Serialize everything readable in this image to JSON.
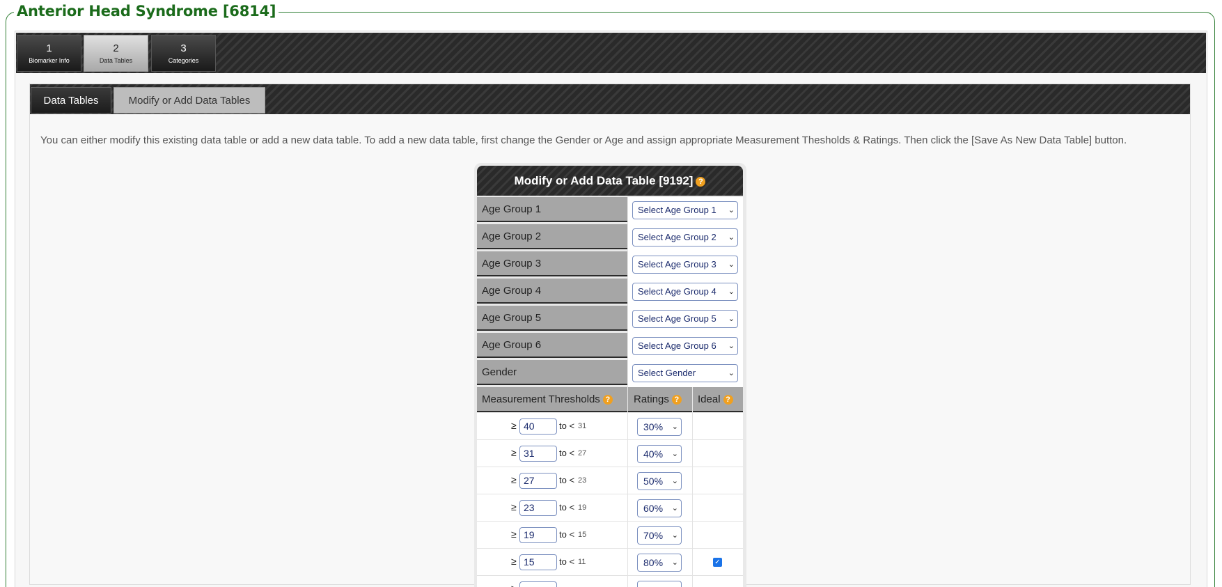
{
  "page": {
    "legend": "Anterior Head Syndrome [6814]",
    "intro": "You can either modify this existing data table or add a new data table. To add a new data table, first change the Gender or Age and assign appropriate Measurement Thesholds & Ratings. Then click the [Save As New Data Table] button."
  },
  "steps": [
    {
      "num": "1",
      "label": "Biomarker Info"
    },
    {
      "num": "2",
      "label": "Data Tables"
    },
    {
      "num": "3",
      "label": "Categories"
    }
  ],
  "tabs": [
    {
      "label": "Data Tables"
    },
    {
      "label": "Modify or Add Data Tables"
    }
  ],
  "form": {
    "title": "Modify or Add Data Table [9192]",
    "fields": [
      {
        "label": "Age Group 1",
        "value": "Select Age Group 1"
      },
      {
        "label": "Age Group 2",
        "value": "Select Age Group 2"
      },
      {
        "label": "Age Group 3",
        "value": "Select Age Group 3"
      },
      {
        "label": "Age Group 4",
        "value": "Select Age Group 4"
      },
      {
        "label": "Age Group 5",
        "value": "Select Age Group 5"
      },
      {
        "label": "Age Group 6",
        "value": "Select Age Group 6"
      },
      {
        "label": "Gender",
        "value": "Select Gender"
      }
    ],
    "headers": {
      "thresholds": "Measurement Thresholds",
      "ratings": "Ratings",
      "ideal": "Ideal"
    },
    "symbols": {
      "ge": "≥",
      "to": "to <",
      "help": "?",
      "chevron": "⌄",
      "check": "✓"
    },
    "rows": [
      {
        "from": "40",
        "to": "31",
        "rating": "30%",
        "ideal": false
      },
      {
        "from": "31",
        "to": "27",
        "rating": "40%",
        "ideal": false
      },
      {
        "from": "27",
        "to": "23",
        "rating": "50%",
        "ideal": false
      },
      {
        "from": "23",
        "to": "19",
        "rating": "60%",
        "ideal": false
      },
      {
        "from": "19",
        "to": "15",
        "rating": "70%",
        "ideal": false
      },
      {
        "from": "15",
        "to": "11",
        "rating": "80%",
        "ideal": true
      },
      {
        "from": "",
        "to": "",
        "rating": "",
        "ideal": false
      }
    ]
  },
  "colors": {
    "legend_green": "#1b6b1b",
    "header_gray": "#a6a6a6",
    "help_orange": "#f0a020",
    "input_border": "#7a8fbf"
  }
}
